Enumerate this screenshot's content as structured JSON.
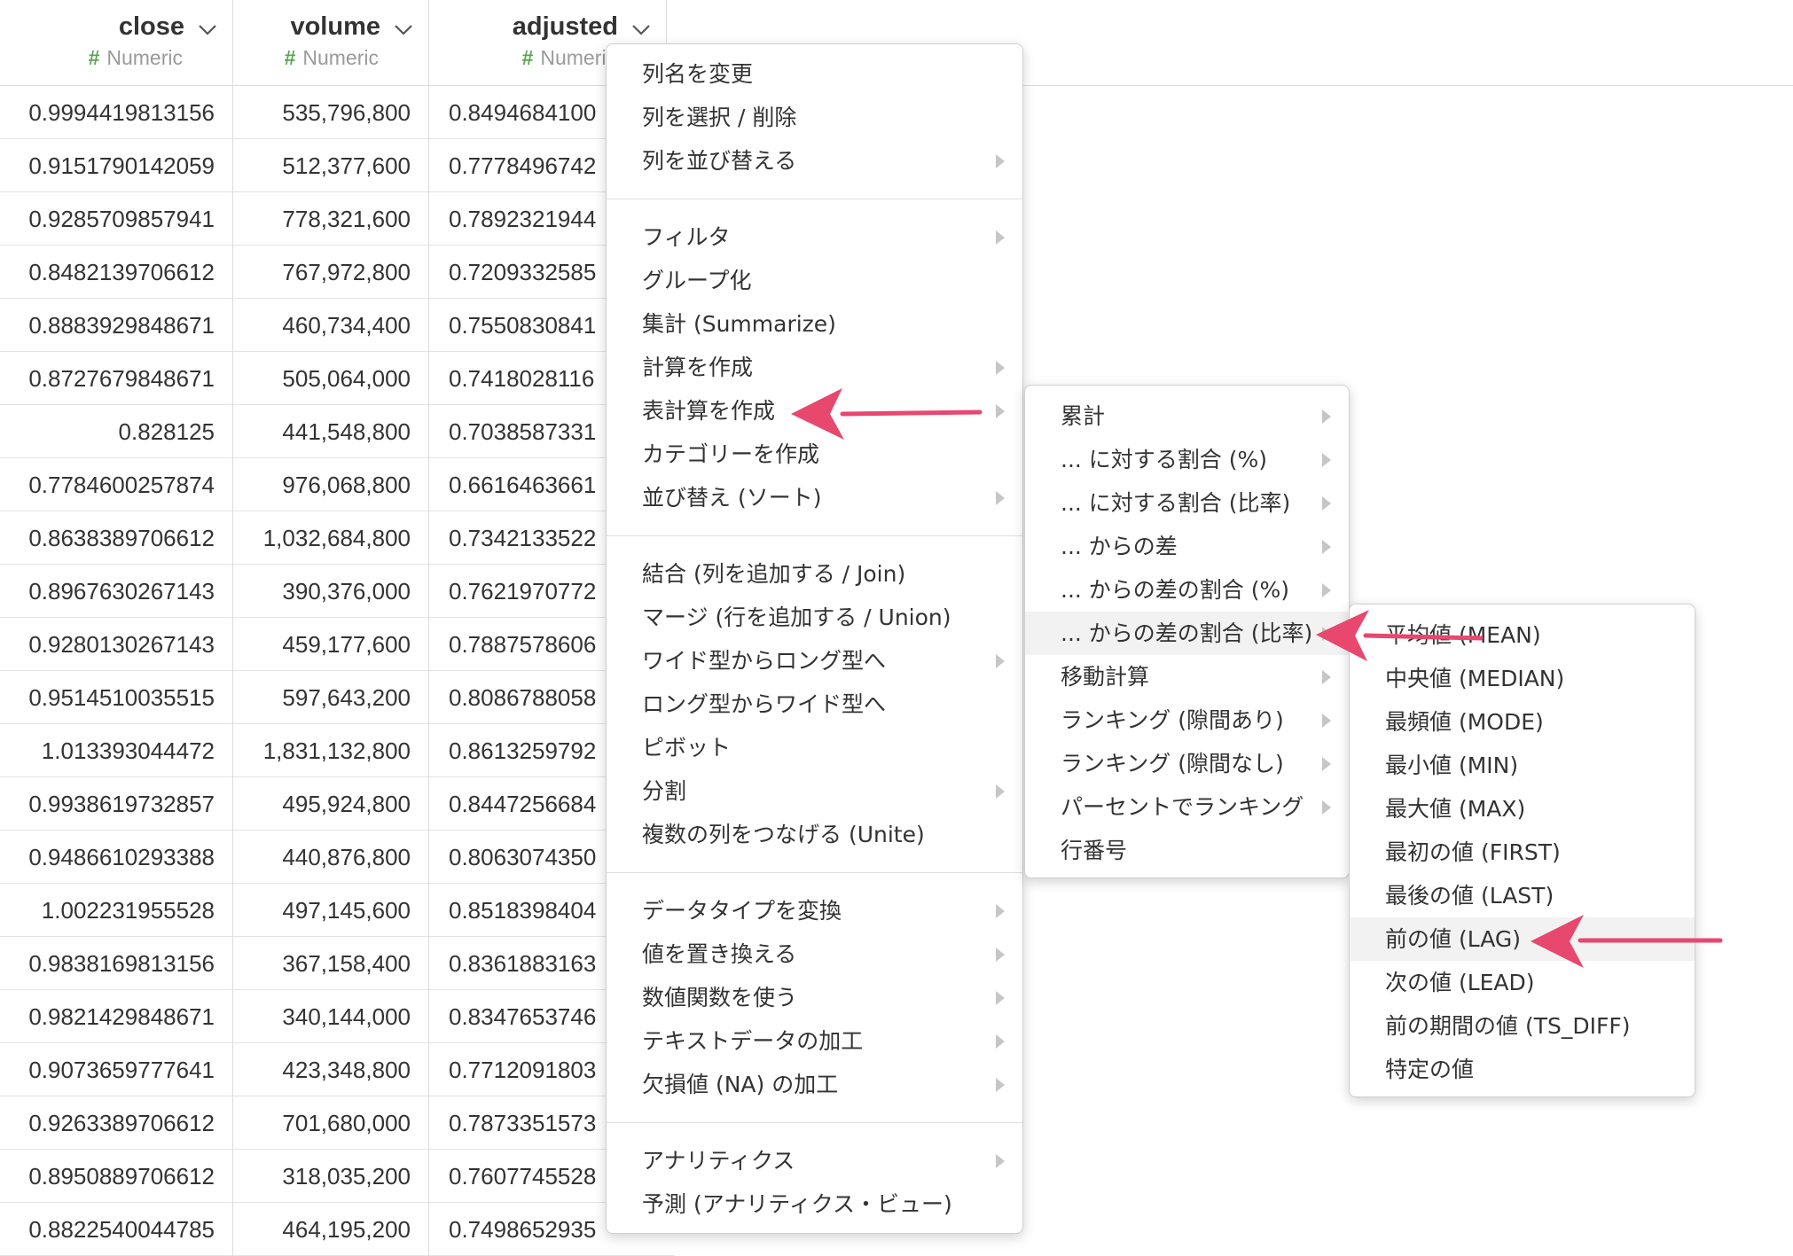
{
  "table": {
    "columns": [
      {
        "name": "close",
        "type": "Numeric"
      },
      {
        "name": "volume",
        "type": "Numeric"
      },
      {
        "name": "adjusted",
        "type": "Numeric"
      }
    ],
    "rows": [
      [
        "0.9994419813156",
        "535,796,800",
        "0.8494684100"
      ],
      [
        "0.9151790142059",
        "512,377,600",
        "0.7778496742"
      ],
      [
        "0.9285709857941",
        "778,321,600",
        "0.7892321944"
      ],
      [
        "0.8482139706612",
        "767,972,800",
        "0.7209332585"
      ],
      [
        "0.8883929848671",
        "460,734,400",
        "0.7550830841"
      ],
      [
        "0.8727679848671",
        "505,064,000",
        "0.7418028116"
      ],
      [
        "0.828125",
        "441,548,800",
        "0.7038587331"
      ],
      [
        "0.7784600257874",
        "976,068,800",
        "0.6616463661"
      ],
      [
        "0.8638389706612",
        "1,032,684,800",
        "0.7342133522"
      ],
      [
        "0.8967630267143",
        "390,376,000",
        "0.7621970772"
      ],
      [
        "0.9280130267143",
        "459,177,600",
        "0.7887578606"
      ],
      [
        "0.9514510035515",
        "597,643,200",
        "0.8086788058"
      ],
      [
        "1.013393044472",
        "1,831,132,800",
        "0.8613259792"
      ],
      [
        "0.9938619732857",
        "495,924,800",
        "0.8447256684"
      ],
      [
        "0.9486610293388",
        "440,876,800",
        "0.8063074350"
      ],
      [
        "1.002231955528",
        "497,145,600",
        "0.8518398404"
      ],
      [
        "0.9838169813156",
        "367,158,400",
        "0.8361883163"
      ],
      [
        "0.9821429848671",
        "340,144,000",
        "0.8347653746"
      ],
      [
        "0.9073659777641",
        "423,348,800",
        "0.7712091803"
      ],
      [
        "0.9263389706612",
        "701,680,000",
        "0.7873351573"
      ],
      [
        "0.8950889706612",
        "318,035,200",
        "0.7607745528"
      ],
      [
        "0.8822540044785",
        "464,195,200",
        "0.7498652935"
      ]
    ]
  },
  "context_menu": {
    "groups": [
      [
        {
          "label": "列名を変更",
          "submenu": false
        },
        {
          "label": "列を選択 / 削除",
          "submenu": false
        },
        {
          "label": "列を並び替える",
          "submenu": true
        }
      ],
      [
        {
          "label": "フィルタ",
          "submenu": true
        },
        {
          "label": "グループ化",
          "submenu": false
        },
        {
          "label": "集計 (Summarize)",
          "submenu": false
        },
        {
          "label": "計算を作成",
          "submenu": true
        },
        {
          "label": "表計算を作成",
          "submenu": true
        },
        {
          "label": "カテゴリーを作成",
          "submenu": false
        },
        {
          "label": "並び替え (ソート)",
          "submenu": true
        }
      ],
      [
        {
          "label": "結合 (列を追加する / Join)",
          "submenu": false
        },
        {
          "label": "マージ (行を追加する / Union)",
          "submenu": false
        },
        {
          "label": "ワイド型からロング型へ",
          "submenu": true
        },
        {
          "label": "ロング型からワイド型へ",
          "submenu": false
        },
        {
          "label": "ピボット",
          "submenu": false
        },
        {
          "label": "分割",
          "submenu": true
        },
        {
          "label": "複数の列をつなげる (Unite)",
          "submenu": false
        }
      ],
      [
        {
          "label": "データタイプを変換",
          "submenu": true
        },
        {
          "label": "値を置き換える",
          "submenu": true
        },
        {
          "label": "数値関数を使う",
          "submenu": true
        },
        {
          "label": "テキストデータの加工",
          "submenu": true
        },
        {
          "label": "欠損値 (NA) の加工",
          "submenu": true
        }
      ],
      [
        {
          "label": "アナリティクス",
          "submenu": true
        },
        {
          "label": "予測 (アナリティクス・ビュー)",
          "submenu": false
        }
      ]
    ]
  },
  "table_calc_submenu": {
    "items": [
      {
        "label": "累計",
        "submenu": true,
        "highlighted": false
      },
      {
        "label": "... に対する割合 (%)",
        "submenu": true,
        "highlighted": false
      },
      {
        "label": "... に対する割合 (比率)",
        "submenu": true,
        "highlighted": false
      },
      {
        "label": "... からの差",
        "submenu": true,
        "highlighted": false
      },
      {
        "label": "... からの差の割合 (%)",
        "submenu": true,
        "highlighted": false
      },
      {
        "label": "... からの差の割合 (比率)",
        "submenu": true,
        "highlighted": true
      },
      {
        "label": "移動計算",
        "submenu": true,
        "highlighted": false
      },
      {
        "label": "ランキング (隙間あり)",
        "submenu": true,
        "highlighted": false
      },
      {
        "label": "ランキング (隙間なし)",
        "submenu": true,
        "highlighted": false
      },
      {
        "label": "パーセントでランキング",
        "submenu": true,
        "highlighted": false
      },
      {
        "label": "行番号",
        "submenu": false,
        "highlighted": false
      }
    ]
  },
  "diff_ratio_submenu": {
    "items": [
      {
        "label": "平均値 (MEAN)",
        "highlighted": false
      },
      {
        "label": "中央値 (MEDIAN)",
        "highlighted": false
      },
      {
        "label": "最頻値 (MODE)",
        "highlighted": false
      },
      {
        "label": "最小値 (MIN)",
        "highlighted": false
      },
      {
        "label": "最大値 (MAX)",
        "highlighted": false
      },
      {
        "label": "最初の値 (FIRST)",
        "highlighted": false
      },
      {
        "label": "最後の値 (LAST)",
        "highlighted": false
      },
      {
        "label": "前の値 (LAG)",
        "highlighted": true
      },
      {
        "label": "次の値 (LEAD)",
        "highlighted": false
      },
      {
        "label": "前の期間の値 (TS_DIFF)",
        "highlighted": false
      },
      {
        "label": "特定の値",
        "highlighted": false
      }
    ]
  },
  "colors": {
    "annotation_arrow": "#e8476e",
    "numeric_hash": "#5aa454",
    "highlight": "#f2f2f2"
  }
}
